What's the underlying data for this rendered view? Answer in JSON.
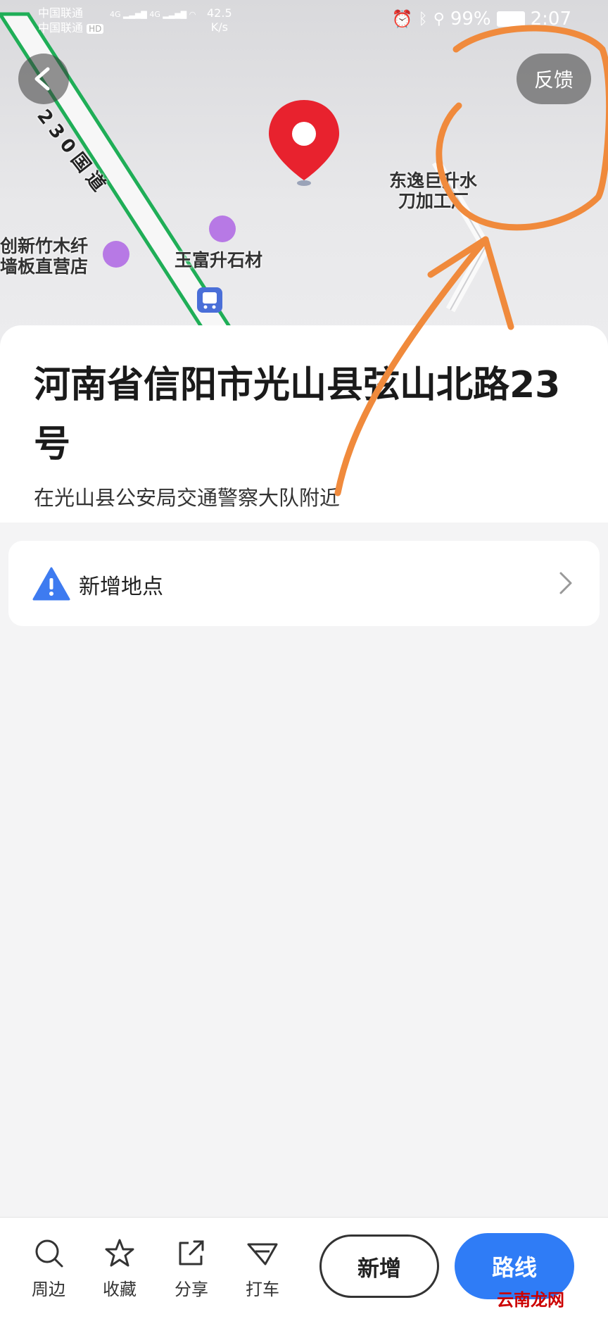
{
  "status_bar": {
    "carrier1": "中国联通",
    "carrier2": "中国联通",
    "hd": "HD",
    "signal1": "4G",
    "signal2": "4G",
    "speed_value": "42.5",
    "speed_unit": "K/s",
    "battery": "99%",
    "time": "2:07"
  },
  "map": {
    "feedback_label": "反馈",
    "road_label": "230国道",
    "poi": [
      {
        "label_line1": "东逸巨升水",
        "label_line2": "刀加工厂"
      },
      {
        "label_line1": "创新竹木纤",
        "label_line2": "墙板直营店"
      },
      {
        "label_line1": "王富升石材"
      }
    ]
  },
  "location": {
    "title": "河南省信阳市光山县弦山北路23号",
    "subtitle": "在光山县公安局交通警察大队附近"
  },
  "add_place": {
    "label": "新增地点"
  },
  "bottom_bar": {
    "nearby": "周边",
    "favorite": "收藏",
    "share": "分享",
    "taxi": "打车",
    "add_button": "新增",
    "route_button": "路线"
  },
  "watermark": "云南龙网",
  "colors": {
    "accent_blue": "#2f7cf6",
    "road_green": "#1fae57",
    "pin_red": "#e8222e",
    "annotation_orange": "#f08a3c",
    "poi_purple": "#b779e5"
  }
}
